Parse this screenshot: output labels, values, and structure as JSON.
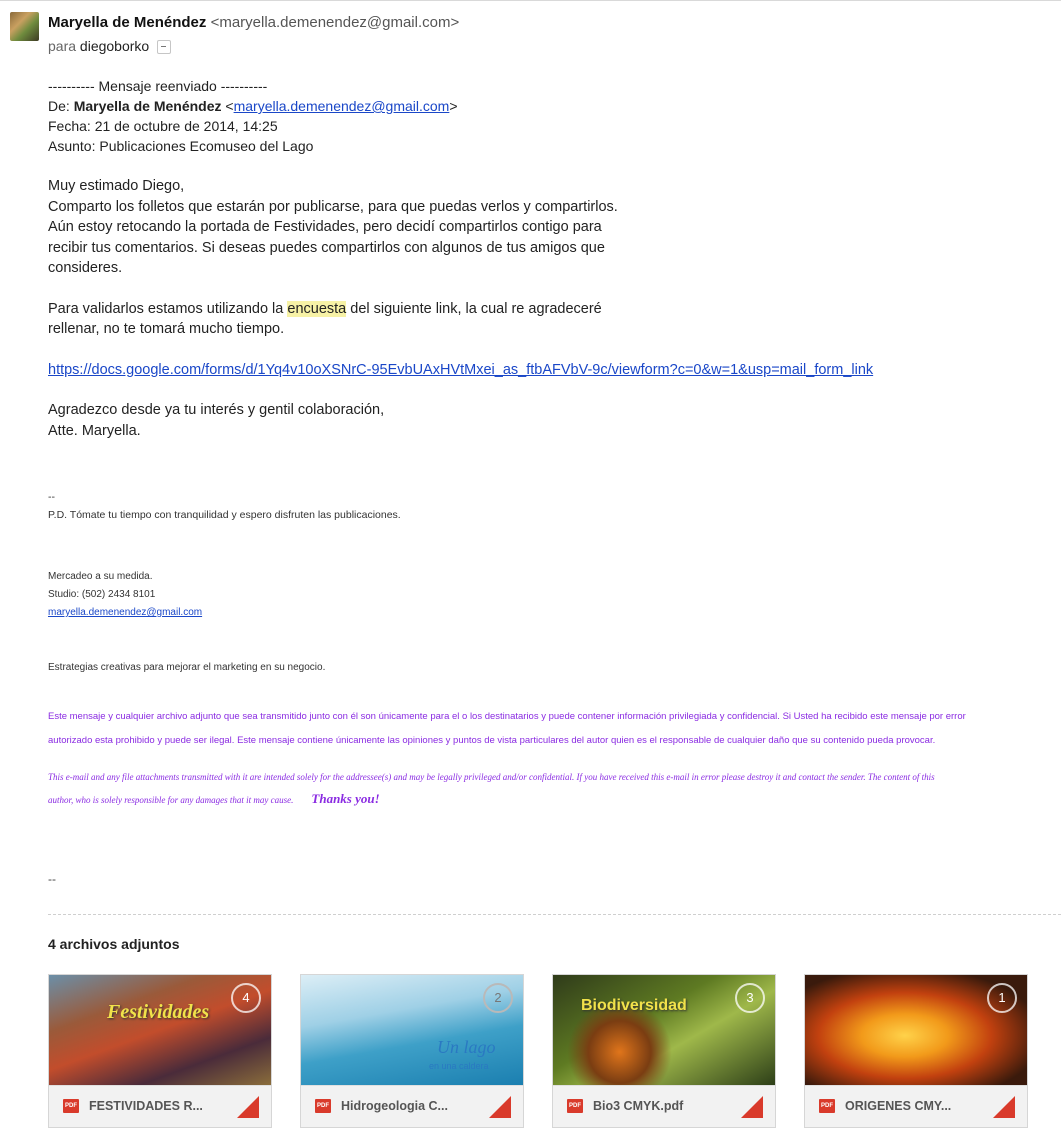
{
  "header": {
    "sender_name": "Maryella de Menéndez",
    "sender_email": "<maryella.demenendez@gmail.com>",
    "to_prefix": "para",
    "to_name": "diegoborko"
  },
  "forwarded": {
    "banner": "---------- Mensaje reenviado ----------",
    "from_label": "De:",
    "from_name": "Maryella de Menéndez",
    "from_email_open": "<",
    "from_email": "maryella.demenendez@gmail.com",
    "from_email_close": ">",
    "date": "Fecha: 21 de octubre de 2014, 14:25",
    "subject": "Asunto: Publicaciones Ecomuseo del Lago"
  },
  "body": {
    "greeting": "Muy estimado Diego,",
    "p1_line1": "Comparto los folletos que estarán por publicarse, para que puedas verlos y compartirlos.",
    "p1_line2": "Aún estoy retocando la portada de Festividades, pero decidí compartirlos contigo para",
    "p1_line3": "recibir tus comentarios. Si deseas puedes compartirlos con algunos de tus amigos que",
    "p1_line4": "consideres.",
    "p2_before": "Para validarlos estamos utilizando la ",
    "p2_highlight": "encuesta",
    "p2_after": " del siguiente link, la cual re agradeceré",
    "p2_line2": "rellenar, no te tomará mucho tiempo.",
    "form_link": "https://docs.google.com/forms/d/1Yq4v10oXSNrC-95EvbUAxHVtMxei_as_ftbAFVbV-9c/viewform?c=0&w=1&usp=mail_form_link",
    "closing_1": "Agradezco desde ya tu interés y gentil colaboración,",
    "closing_2": "Atte. Maryella."
  },
  "signature": {
    "dash": "--",
    "pd": "P.D. Tómate tu tiempo con tranquilidad y espero disfruten las publicaciones.",
    "line1": "Mercadeo a su medida.",
    "line2": "Studio: (502) 2434 8101",
    "email": "maryella.demenendez@gmail.com",
    "strategy": "Estrategias creativas para mejorar el marketing en su negocio.",
    "disclaimer_es_1": "Este mensaje y cualquier archivo adjunto que sea transmitido junto con él son únicamente para el o los destinatarios y puede contener información privilegiada y confidencial. Si Usted ha recibido este mensaje por error",
    "disclaimer_es_2": "autorizado esta prohibido y puede ser ilegal. Este mensaje contiene únicamente las opiniones y puntos de vista particulares del autor quien es el responsable de cualquier daño que su contenido pueda provocar.",
    "disclaimer_en_1": "This e-mail and any file attachments transmitted with it are intended solely for the addressee(s) and may be legally privileged and/or confidential. If you have received this e-mail in error please destroy it and contact the sender. The content of this",
    "disclaimer_en_2": "author, who is solely responsible for any damages that it may cause.",
    "thanks": "Thanks you!",
    "dash2": "--"
  },
  "attachments": {
    "title": "4 archivos adjuntos",
    "items": [
      {
        "thumb_title": "Festividades",
        "badge": "4",
        "filename": "FESTIVIDADES R...",
        "icon": "pdf-icon"
      },
      {
        "thumb_title": "Un lago",
        "thumb_sub": "en una caldera",
        "badge": "2",
        "filename": "Hidrogeologia C...",
        "icon": "pdf-icon"
      },
      {
        "thumb_title": "Biodiversidad",
        "badge": "3",
        "filename": "Bio3 CMYK.pdf",
        "icon": "pdf-icon"
      },
      {
        "thumb_title": "",
        "badge": "1",
        "filename": "ORIGENES CMY...",
        "icon": "pdf-icon"
      }
    ]
  },
  "colors": {
    "link": "#1a47c8",
    "disclaimer": "#8a2be2",
    "highlight": "#f7f2a6",
    "pdf_red": "#d93a2b"
  }
}
